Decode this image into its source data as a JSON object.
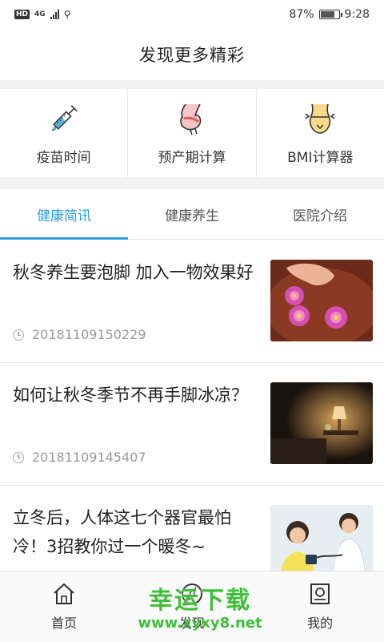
{
  "status_bar": {
    "network": "4G",
    "hd": "HD",
    "battery": "87%",
    "battery_level": 0.87,
    "time": "9:28"
  },
  "header": {
    "title": "发现更多精彩"
  },
  "tools": [
    {
      "label": "疫苗时间",
      "icon": "syringe-icon"
    },
    {
      "label": "预产期计算",
      "icon": "pregnancy-icon"
    },
    {
      "label": "BMI计算器",
      "icon": "waist-measure-icon"
    }
  ],
  "tabs": [
    {
      "label": "健康简讯",
      "active": true
    },
    {
      "label": "健康养生",
      "active": false
    },
    {
      "label": "医院介绍",
      "active": false
    }
  ],
  "news": [
    {
      "title": "秋冬养生要泡脚 加入一物效果好",
      "time": "20181109150229",
      "thumb": "foot-soak-flowers-image"
    },
    {
      "title": "如何让秋冬季节不再手脚冰凉？",
      "time": "20181109145407",
      "thumb": "bedroom-lamp-image"
    },
    {
      "title": "立冬后，人体这七个器官最怕冷！3招教你过一个暖冬~",
      "time": "",
      "thumb": "blood-pressure-check-image"
    }
  ],
  "bottom_nav": [
    {
      "label": "首页",
      "icon": "home-icon"
    },
    {
      "label": "发现",
      "icon": "discover-icon"
    },
    {
      "label": "我的",
      "icon": "profile-icon"
    }
  ],
  "watermark": {
    "main": "幸运下载",
    "url": "www.xyxy8.net"
  },
  "colors": {
    "accent": "#2a9fd8",
    "watermark": "#3fbf3a"
  }
}
